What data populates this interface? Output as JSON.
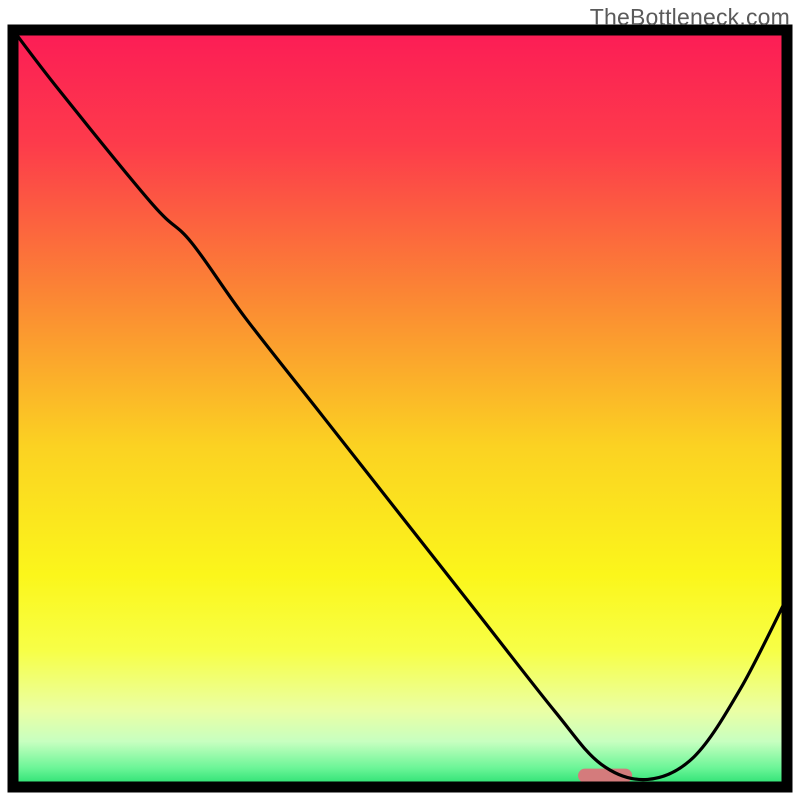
{
  "watermark": "TheBottleneck.com",
  "chart_data": {
    "type": "line",
    "title": "",
    "xlabel": "",
    "ylabel": "",
    "xlim": [
      0,
      100
    ],
    "ylim": [
      0,
      100
    ],
    "grid": false,
    "legend": false,
    "annotations": [],
    "series": [
      {
        "name": "curve",
        "x": [
          0,
          6,
          18,
          23,
          30,
          40,
          50,
          60,
          70,
          76,
          82,
          88,
          94,
          100
        ],
        "values": [
          100,
          92,
          77,
          72,
          62,
          49,
          36,
          23,
          10,
          3,
          1,
          4,
          13,
          25
        ]
      }
    ],
    "marker": {
      "x_start": 73,
      "x_end": 80,
      "y": 1.5,
      "color": "#d47b7c"
    },
    "background": {
      "type": "vertical-gradient",
      "stops": [
        {
          "pos": 0.0,
          "color": "#fc1c56"
        },
        {
          "pos": 0.15,
          "color": "#fd3b4b"
        },
        {
          "pos": 0.35,
          "color": "#fb8634"
        },
        {
          "pos": 0.55,
          "color": "#fbd222"
        },
        {
          "pos": 0.72,
          "color": "#fbf61b"
        },
        {
          "pos": 0.82,
          "color": "#f7ff47"
        },
        {
          "pos": 0.9,
          "color": "#eaffa5"
        },
        {
          "pos": 0.94,
          "color": "#c7ffc0"
        },
        {
          "pos": 0.975,
          "color": "#6bf597"
        },
        {
          "pos": 1.0,
          "color": "#22de6e"
        }
      ]
    },
    "border": {
      "color": "#000000",
      "width": 11
    }
  }
}
